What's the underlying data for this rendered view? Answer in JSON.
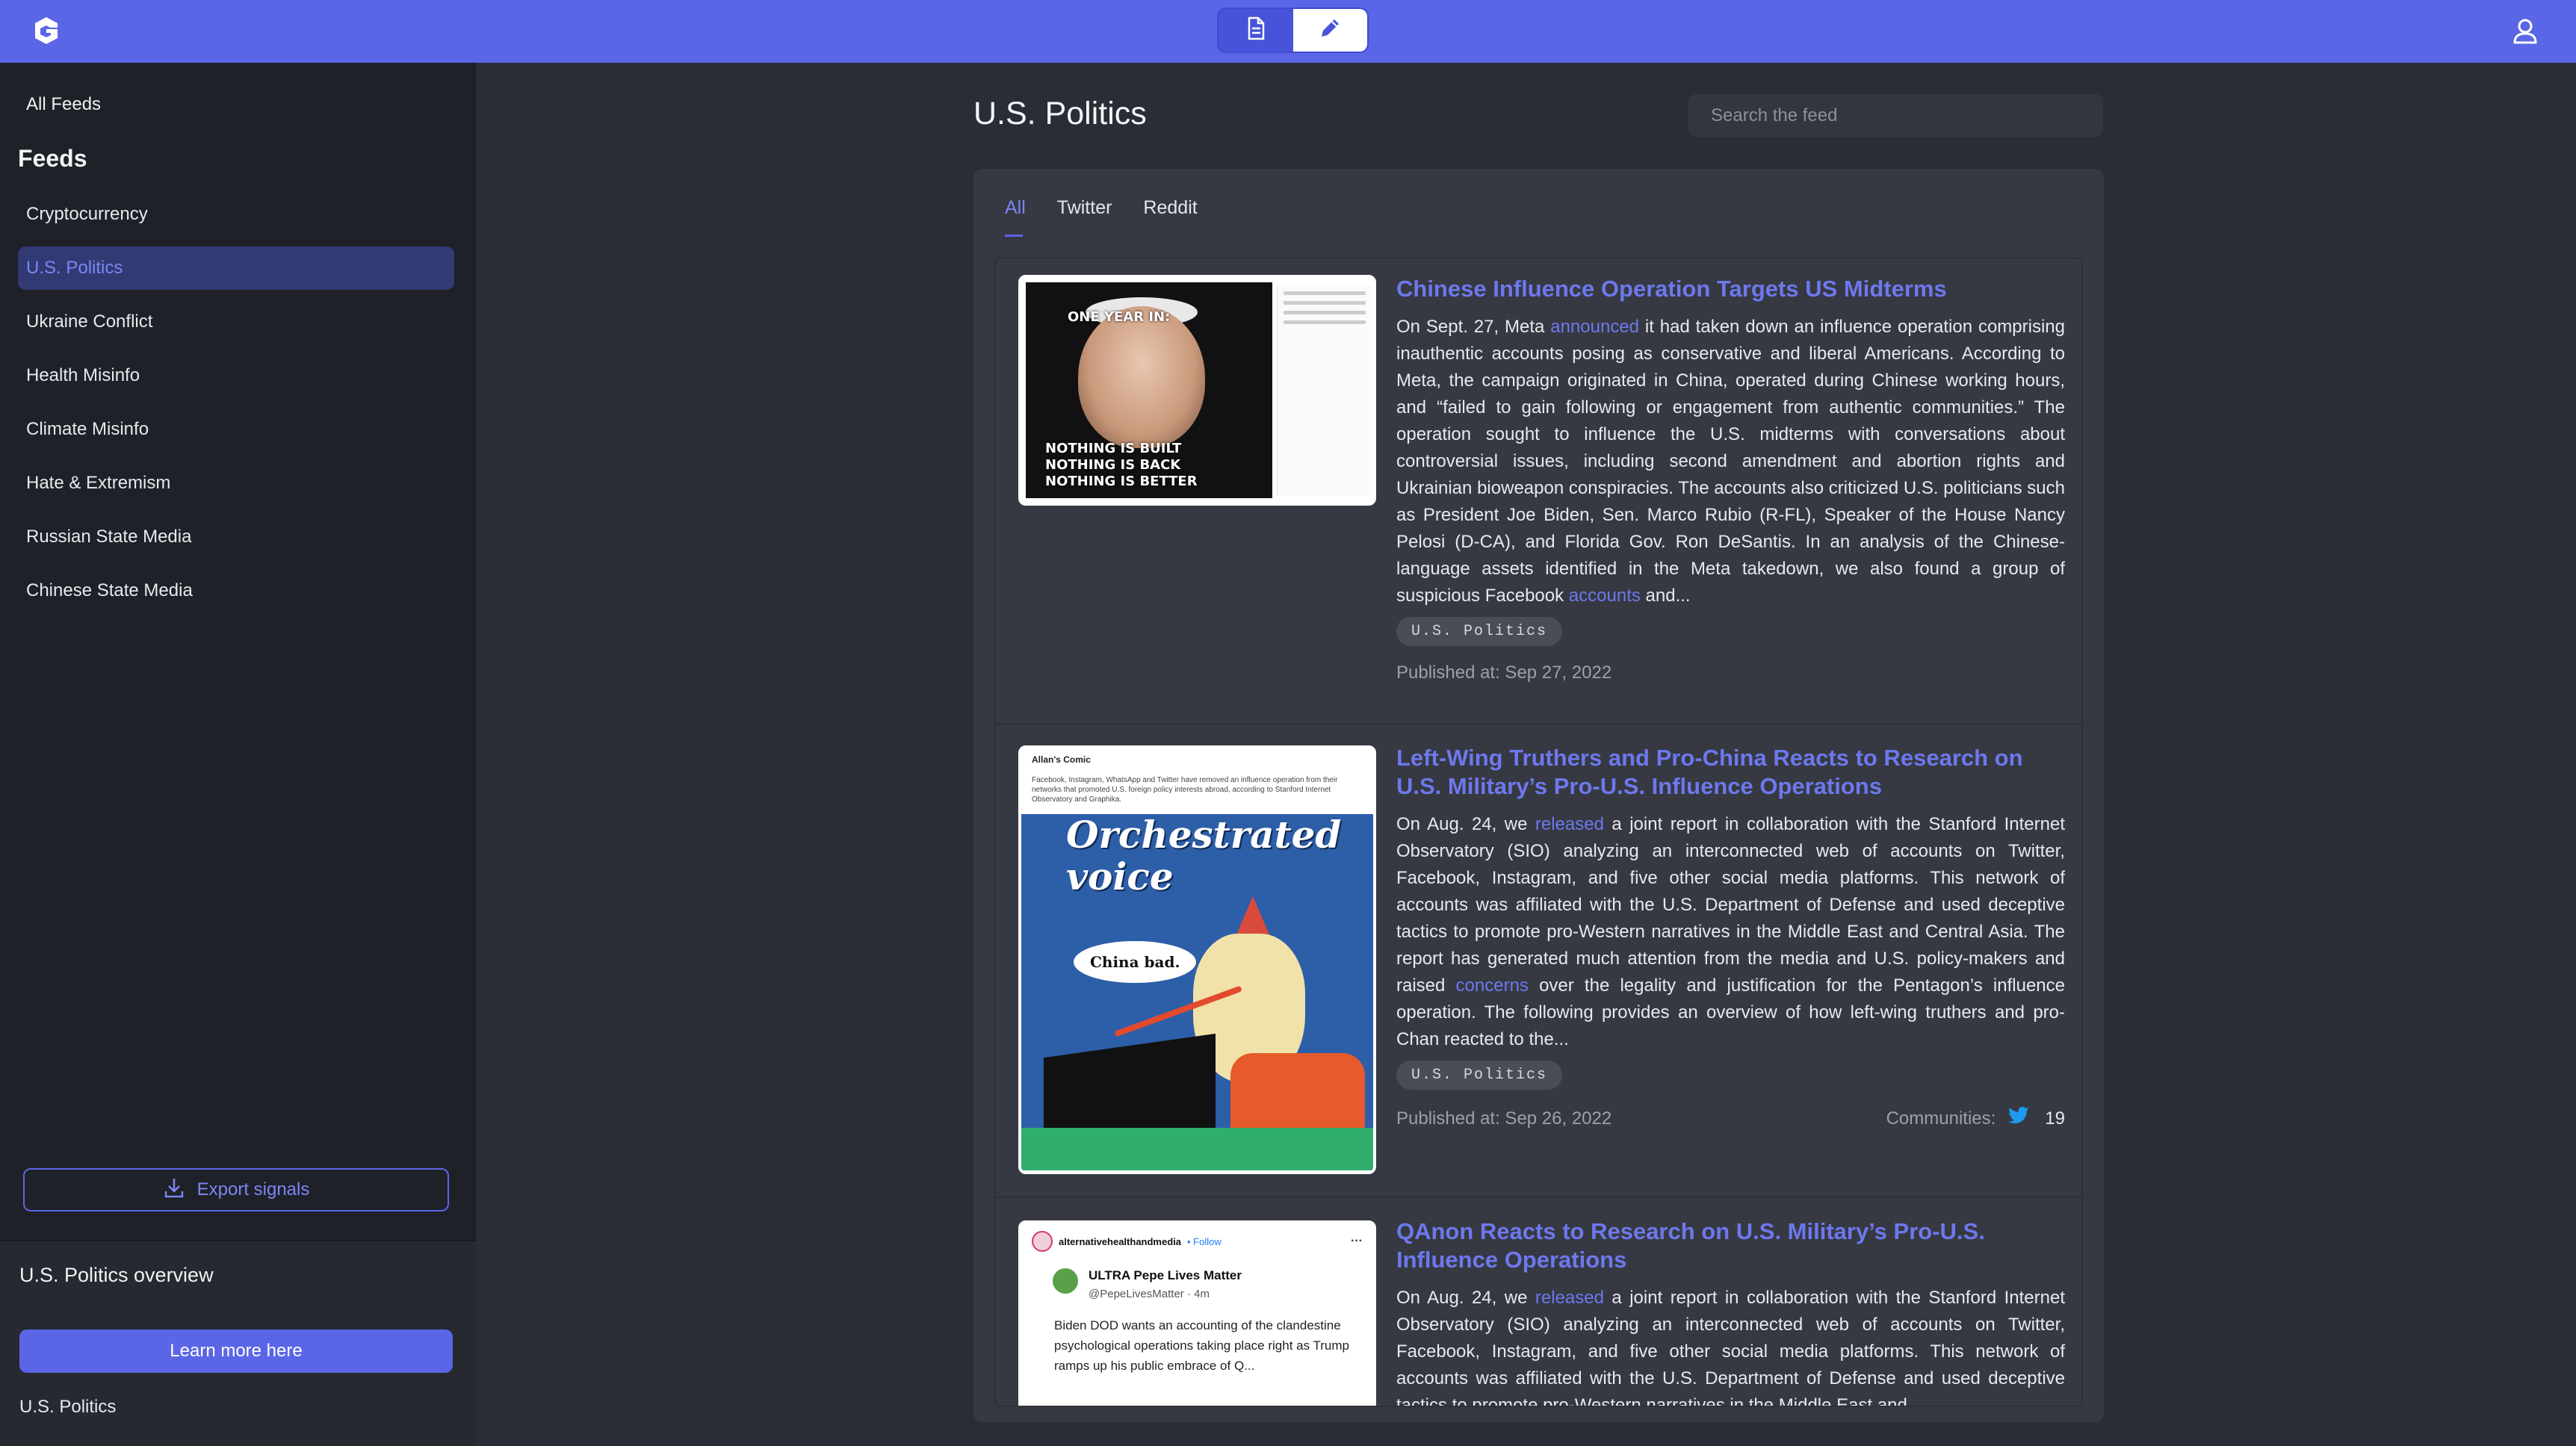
{
  "topbar": {
    "logo_icon": "g-logo-icon",
    "toggle": {
      "doc_icon": "document-icon",
      "edit_icon": "pencil-icon"
    },
    "user_icon": "user-icon"
  },
  "sidebar": {
    "all_feeds": "All Feeds",
    "feeds_heading": "Feeds",
    "items": [
      {
        "label": "Cryptocurrency",
        "active": false
      },
      {
        "label": "U.S. Politics",
        "active": true
      },
      {
        "label": "Ukraine Conflict",
        "active": false
      },
      {
        "label": "Health Misinfo",
        "active": false
      },
      {
        "label": "Climate Misinfo",
        "active": false
      },
      {
        "label": "Hate & Extremism",
        "active": false
      },
      {
        "label": "Russian State Media",
        "active": false
      },
      {
        "label": "Chinese State Media",
        "active": false
      }
    ],
    "export_label": "Export signals",
    "overview": {
      "title": "U.S. Politics overview",
      "button": "Learn more here",
      "footer": "U.S. Politics"
    }
  },
  "main": {
    "title": "U.S. Politics",
    "search_placeholder": "Search the feed",
    "tabs": [
      {
        "label": "All",
        "active": true
      },
      {
        "label": "Twitter",
        "active": false
      },
      {
        "label": "Reddit",
        "active": false
      }
    ],
    "cards": [
      {
        "title": "Chinese Influence Operation Targets US Midterms",
        "text_pre": "On Sept. 27, Meta ",
        "link1": "announced",
        "text_mid": " it had taken down an influence operation comprising inauthentic accounts posing as conservative and liberal Americans. According to Meta, the campaign originated in China, operated during Chinese working hours, and “failed to gain following or engagement from authentic communities.”  The operation sought to influence the U.S. midterms with conversations about controversial issues, including second amendment and abortion rights and Ukrainian bioweapon conspiracies. The accounts also criticized U.S. politicians such as President Joe Biden, Sen. Marco Rubio (R-FL), Speaker of the House Nancy Pelosi (D-CA), and Florida Gov. Ron DeSantis. In an analysis of the Chinese-language assets identified in the Meta takedown, we also found a group of suspicious Facebook ",
        "link2": "accounts",
        "text_post": " and...",
        "tag": "U.S. Politics",
        "published": "Published at: Sep 27, 2022",
        "image": {
          "top_caption": "ONE YEAR IN:",
          "bottom_caption": [
            "NOTHING IS BUILT",
            "NOTHING IS BACK",
            "NOTHING IS BETTER"
          ]
        }
      },
      {
        "title": "Left-Wing Truthers and Pro-China Reacts to Research on U.S. Military’s Pro-U.S. Influence Operations",
        "text_pre": "On Aug. 24, we ",
        "link1": "released",
        "text_mid": " a joint report in collaboration with the Stanford Internet Observatory (SIO) analyzing an interconnected web of accounts on Twitter, Facebook, Instagram, and five other social media platforms. This network of accounts was affiliated with the U.S. Department of Defense and used deceptive tactics to promote pro-Western narratives in the Middle East and Central Asia. The report has generated much attention from the media and U.S. policy-makers and raised ",
        "link2": "concerns",
        "text_post": " over the legality and justification for the Pentagon’s influence operation. The following provides an overview of how left-wing truthers and pro-Chan reacted to the...",
        "tag": "U.S. Politics",
        "published": "Published at: Sep 26, 2022",
        "communities_label": "Communities:",
        "communities_icon": "twitter-bird-icon",
        "communities_count": "19",
        "image": {
          "account": "Allan's Comic",
          "post_text": "Facebook, Instagram, WhatsApp and Twitter have removed an influence operation from their networks that promoted U.S. foreign policy interests abroad, according to Stanford Internet Observatory and Graphika.",
          "headline": "Orchestrated voice",
          "bubble": "China bad."
        }
      },
      {
        "title": "QAnon Reacts to Research on U.S. Military’s Pro-U.S. Influence Operations",
        "text_pre": "On Aug. 24, we ",
        "link1": "released",
        "text_mid": " a joint report in collaboration with the Stanford Internet Observatory (SIO) analyzing an interconnected web of accounts on Twitter, Facebook, Instagram, and five other social media platforms. This network of accounts was affiliated with the U.S. Department of Defense and used deceptive tactics to promote pro-Western narratives in the Middle East and",
        "link2": "",
        "text_post": "",
        "tag": "",
        "published": "",
        "image": {
          "account": "alternativehealthandmedia",
          "follow": "• Follow",
          "tweet_name": "ULTRA Pepe Lives Matter",
          "tweet_handle": "@PepeLivesMatter · 4m",
          "tweet_body": "Biden DOD wants an accounting of the clandestine psychological operations taking place right as Trump ramps up his public embrace of Q..."
        }
      }
    ]
  },
  "colors": {
    "accent": "#5a66e6",
    "link": "#6d78ee",
    "sidebar_bg": "#1f2128",
    "main_bg": "#2a2d35",
    "panel_bg": "#363941"
  }
}
